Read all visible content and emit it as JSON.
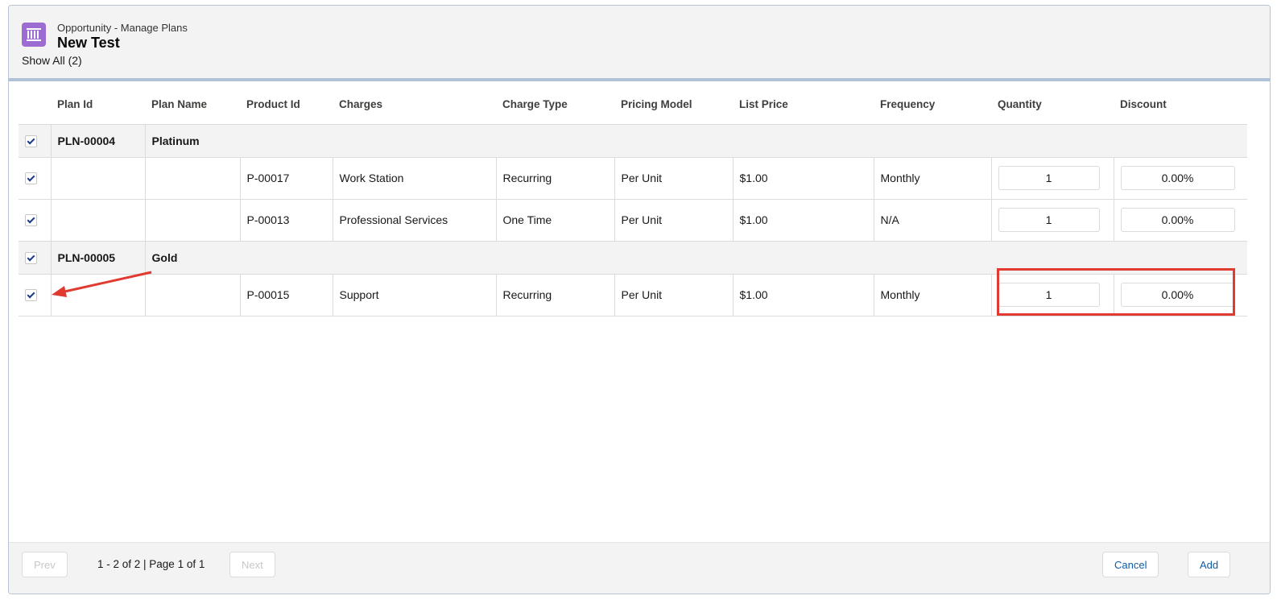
{
  "header": {
    "object_name": "Opportunity - Manage Plans",
    "record_name": "New Test",
    "show_all": "Show All (2)",
    "icon": "price-book-icon"
  },
  "table": {
    "columns": [
      "Plan Id",
      "Plan Name",
      "Product Id",
      "Charges",
      "Charge Type",
      "Pricing Model",
      "List Price",
      "Frequency",
      "Quantity",
      "Discount"
    ],
    "groups": [
      {
        "plan_id": "PLN-00004",
        "plan_name": "Platinum",
        "checked": true,
        "items": [
          {
            "product_id": "P-00017",
            "charge": "Work Station",
            "charge_type": "Recurring",
            "pricing_model": "Per Unit",
            "list_price": "$1.00",
            "frequency": "Monthly",
            "quantity": "1",
            "discount": "0.00%",
            "checked": true
          },
          {
            "product_id": "P-00013",
            "charge": "Professional Services",
            "charge_type": "One Time",
            "pricing_model": "Per Unit",
            "list_price": "$1.00",
            "frequency": "N/A",
            "quantity": "1",
            "discount": "0.00%",
            "checked": true
          }
        ]
      },
      {
        "plan_id": "PLN-00005",
        "plan_name": "Gold",
        "checked": true,
        "items": [
          {
            "product_id": "P-00015",
            "charge": "Support",
            "charge_type": "Recurring",
            "pricing_model": "Per Unit",
            "list_price": "$1.00",
            "frequency": "Monthly",
            "quantity": "1",
            "discount": "0.00%",
            "checked": true
          }
        ]
      }
    ]
  },
  "footer": {
    "prev_label": "Prev",
    "next_label": "Next",
    "page_info": "1 - 2 of 2 | Page 1 of 1",
    "cancel_label": "Cancel",
    "add_label": "Add"
  },
  "colors": {
    "accent": "#0b5cab",
    "icon_bg": "#9c6cd3",
    "annotation": "#e13a31"
  }
}
